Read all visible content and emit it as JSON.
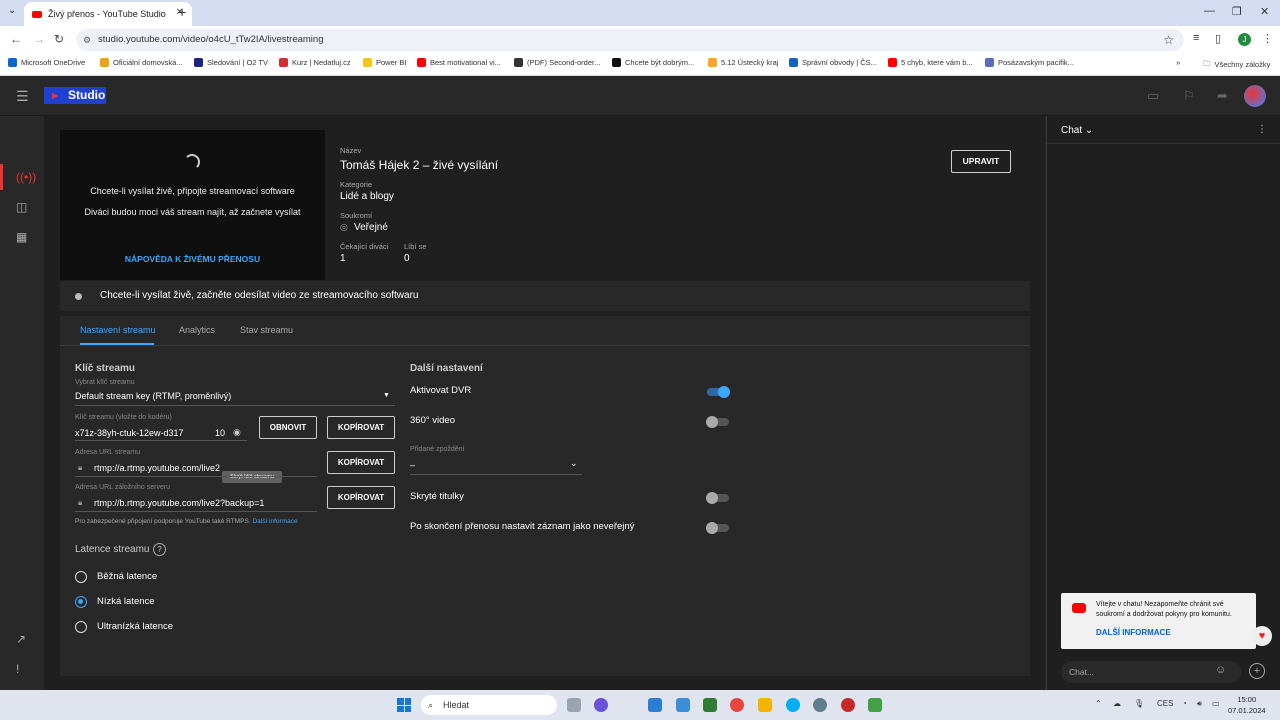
{
  "browser": {
    "tab_title": "Živý přenos - YouTube Studio",
    "url": "studio.youtube.com/video/o4cU_tTw2IA/livestreaming",
    "profile_letter": "J",
    "bookmarks": [
      {
        "label": "Microsoft OneDrive",
        "color": "#0a64d6"
      },
      {
        "label": "Oficiální domovská...",
        "color": "#e8a317"
      },
      {
        "label": "Sledování | O2 TV",
        "color": "#1a237e"
      },
      {
        "label": "Kurz | Nedatluj.cz",
        "color": "#d32f2f"
      },
      {
        "label": "Power BI",
        "color": "#f2c811"
      },
      {
        "label": "Best motivational vi...",
        "color": "#ff0000"
      },
      {
        "label": "(PDF) Second-order...",
        "color": "#333333"
      },
      {
        "label": "Chcete být dobrým...",
        "color": "#111111"
      },
      {
        "label": "5.12 Ústecký kraj",
        "color": "#f9a825"
      },
      {
        "label": "Správní obvody | ČS...",
        "color": "#1565c0"
      },
      {
        "label": "5 chyb, které vám b...",
        "color": "#ff0000"
      },
      {
        "label": "Posázavským pacifik...",
        "color": "#5c6bc0"
      }
    ],
    "all_bookmarks": "Všechny záložky"
  },
  "studio": {
    "logo": "Studio"
  },
  "preview": {
    "line1": "Chcete-li vysílat živě, připojte streamovací software",
    "line2": "Diváci budou moci váš stream najít, až začnete vysílat",
    "help": "NÁPOVĚDA K ŽIVÉMU PŘENOSU"
  },
  "info": {
    "title_label": "Název",
    "title": "Tomáš Hájek 2 – živé vysílání",
    "category_label": "Kategorie",
    "category": "Lidé a blogy",
    "privacy_label": "Soukromí",
    "privacy": "Veřejné",
    "waiting_label": "Čekající diváci",
    "waiting": "1",
    "likes_label": "Líbí se",
    "likes": "0",
    "edit": "UPRAVIT"
  },
  "status": "Chcete-li vysílat živě, začněte odesílat video ze streamovacího softwaru",
  "tabs": [
    "Nastavení streamu",
    "Analytics",
    "Stav streamu"
  ],
  "stream_key": {
    "heading": "Klíč streamu",
    "select_label": "Vybrat klíč streamu",
    "select_value": "Default stream key (RTMP, proměnlivý)",
    "key_label": "Klíč streamu (vložte do kodéru)",
    "key_value": "x71z-38yh-ctuk-12ew-d317",
    "key_suffix": "10",
    "tooltip": "Skrýt klíč streamu",
    "refresh": "OBNOVIT",
    "copy": "KOPÍROVAT",
    "url_label": "Adresa URL streamu",
    "url_value": "rtmp://a.rtmp.youtube.com/live2",
    "backup_label": "Adresa URL záložního serveru",
    "backup_value": "rtmp://b.rtmp.youtube.com/live2?backup=1",
    "note": "Pro zabezpečené připojení podporuje YouTube také RTMPS.",
    "note_link": "Další informace"
  },
  "latency": {
    "heading": "Latence streamu",
    "options": [
      "Běžná latence",
      "Nízká latence",
      "Ultranízká latence"
    ],
    "selected": 1
  },
  "more_settings": {
    "heading": "Další nastavení",
    "dvr": "Aktivovat DVR",
    "dvr_on": true,
    "video360": "360° video",
    "delay_label": "Přidané zpoždění",
    "delay_value": "–",
    "captions": "Skryté titulky",
    "unlisted": "Po skončení přenosu nastavit záznam jako neveřejný"
  },
  "chat": {
    "title": "Chat",
    "welcome": "Vítejte v chatu! Nezapomeňte chránit své soukromí a dodržovat pokyny pro komunitu.",
    "welcome_link": "DALŠÍ INFORMACE",
    "input_placeholder": "Chat..."
  },
  "taskbar": {
    "search": "Hledat",
    "lang": "CES",
    "time": "15:00",
    "date": "07.01.2024"
  }
}
